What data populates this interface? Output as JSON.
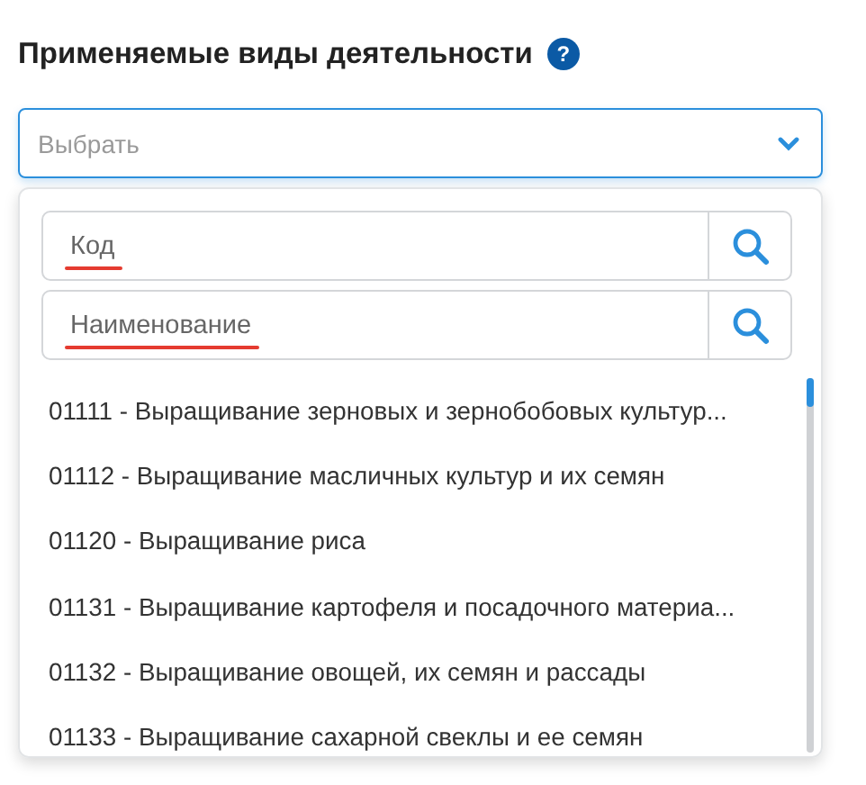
{
  "title": "Применяемые виды деятельности",
  "help": {
    "icon": "?"
  },
  "select": {
    "placeholder": "Выбрать",
    "expanded": true
  },
  "search_fields": [
    {
      "placeholder": "Код",
      "marked": true
    },
    {
      "placeholder": "Наименование",
      "marked": true
    }
  ],
  "items": [
    {
      "label": "01111 - Выращивание зерновых и зернобобовых культур..."
    },
    {
      "label": "01112 - Выращивание масличных культур и их семян"
    },
    {
      "label": "01120 - Выращивание риса"
    },
    {
      "label": "01131 - Выращивание картофеля и посадочного материа..."
    },
    {
      "label": "01132 - Выращивание овощей, их семян и рассады"
    },
    {
      "label": "01133 - Выращивание сахарной свеклы и ее семян"
    }
  ]
}
